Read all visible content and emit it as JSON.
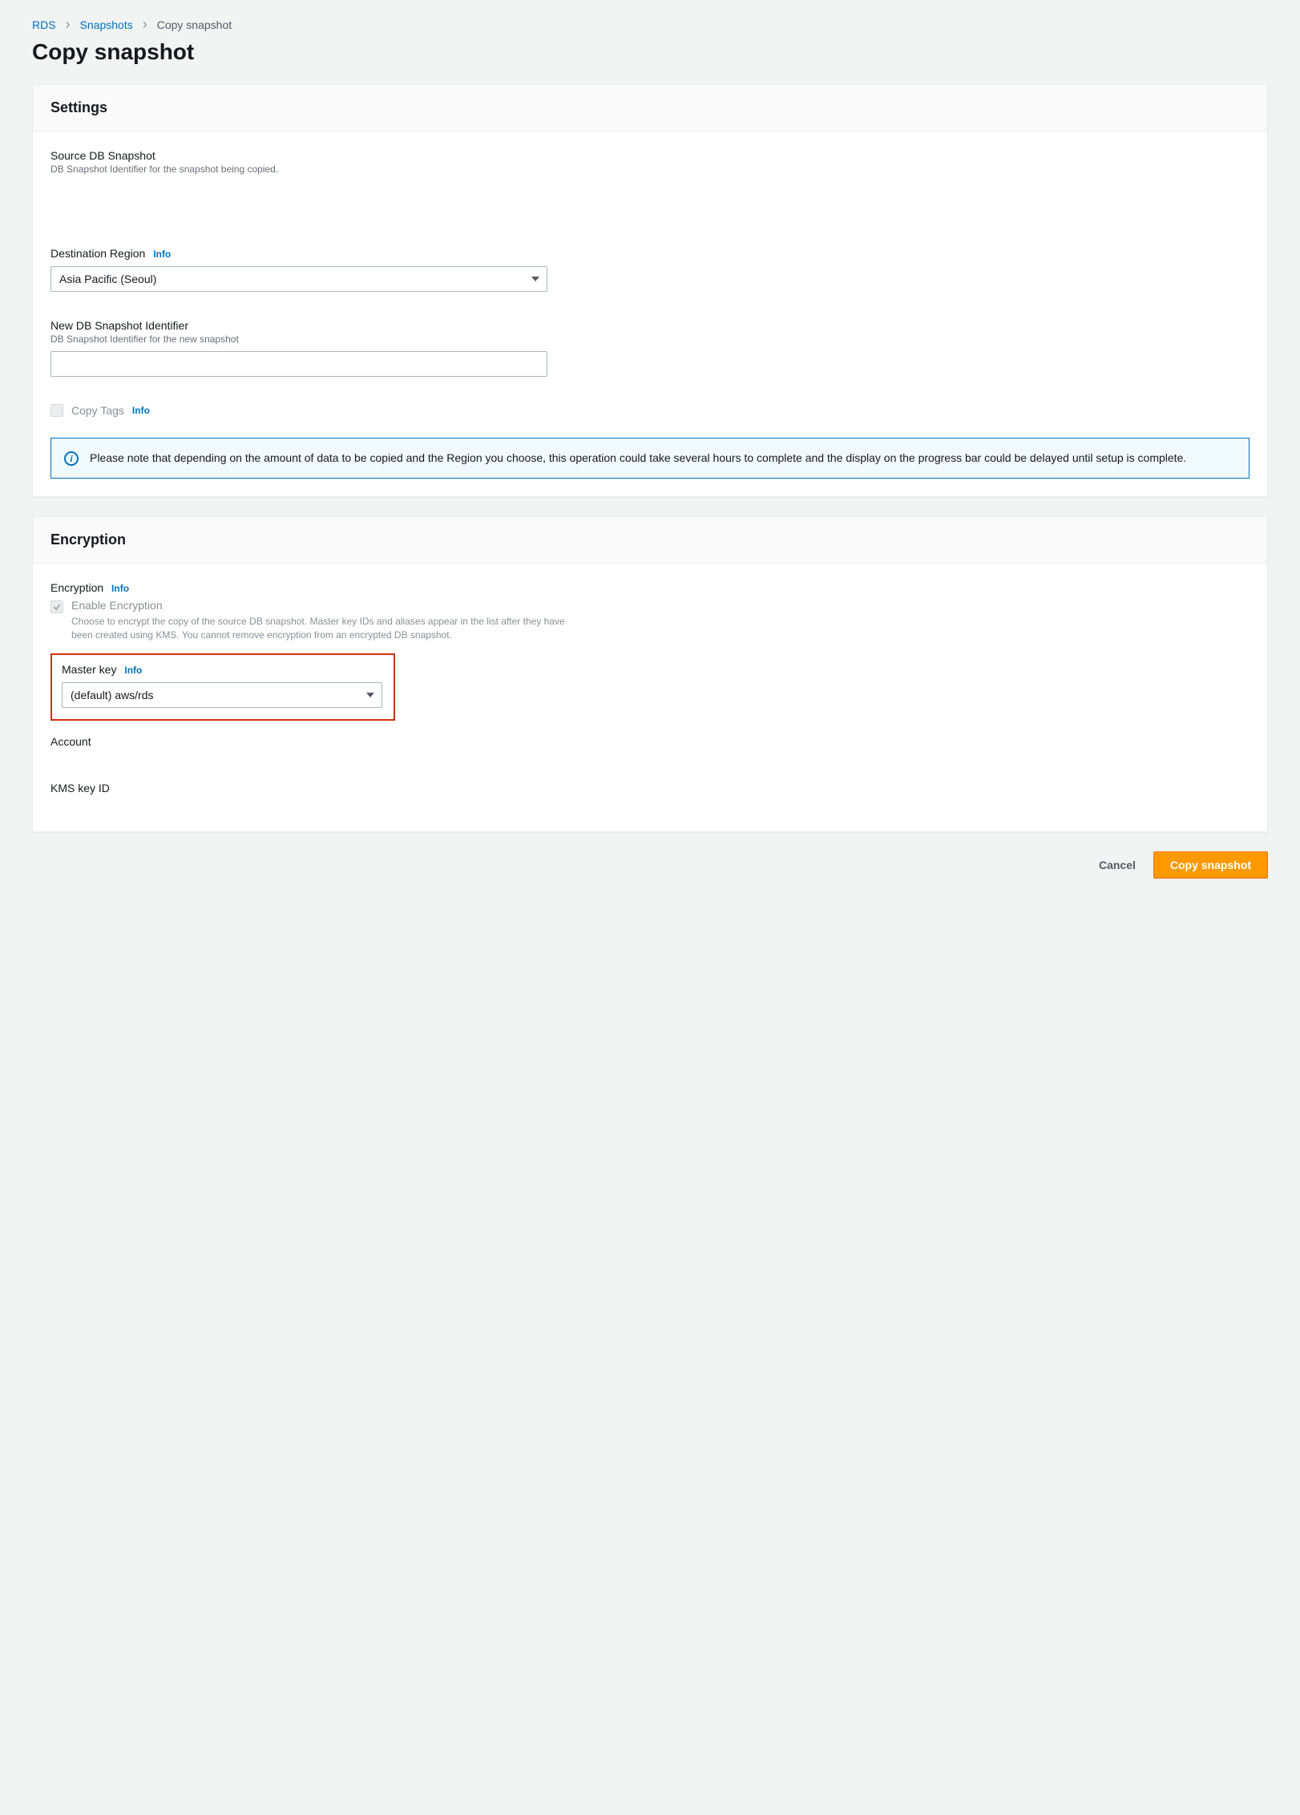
{
  "breadcrumb": {
    "items": [
      {
        "label": "RDS",
        "link": true
      },
      {
        "label": "Snapshots",
        "link": true
      },
      {
        "label": "Copy snapshot",
        "link": false
      }
    ]
  },
  "page_title": "Copy snapshot",
  "settings": {
    "heading": "Settings",
    "source": {
      "label": "Source DB Snapshot",
      "sublabel": "DB Snapshot Identifier for the snapshot being copied."
    },
    "destination": {
      "label": "Destination Region",
      "info": "Info",
      "value": "Asia Pacific (Seoul)"
    },
    "new_identifier": {
      "label": "New DB Snapshot Identifier",
      "sublabel": "DB Snapshot Identifier for the new snapshot",
      "value": ""
    },
    "copy_tags": {
      "label": "Copy Tags",
      "info": "Info",
      "checked": false,
      "disabled": true
    },
    "alert": "Please note that depending on the amount of data to be copied and the Region you choose, this operation could take several hours to complete and the display on the progress bar could be delayed until setup is complete."
  },
  "encryption": {
    "heading": "Encryption",
    "section_label": "Encryption",
    "section_info": "Info",
    "enable": {
      "label": "Enable Encryption",
      "sublabel": "Choose to encrypt the copy of the source DB snapshot. Master key IDs and aliases appear in the list after they have been created using KMS. You cannot remove encryption from an encrypted DB snapshot.",
      "checked": true,
      "disabled": true
    },
    "master_key": {
      "label": "Master key",
      "info": "Info",
      "value": "(default) aws/rds"
    },
    "account_label": "Account",
    "kms_label": "KMS key ID"
  },
  "actions": {
    "cancel": "Cancel",
    "submit": "Copy snapshot"
  }
}
